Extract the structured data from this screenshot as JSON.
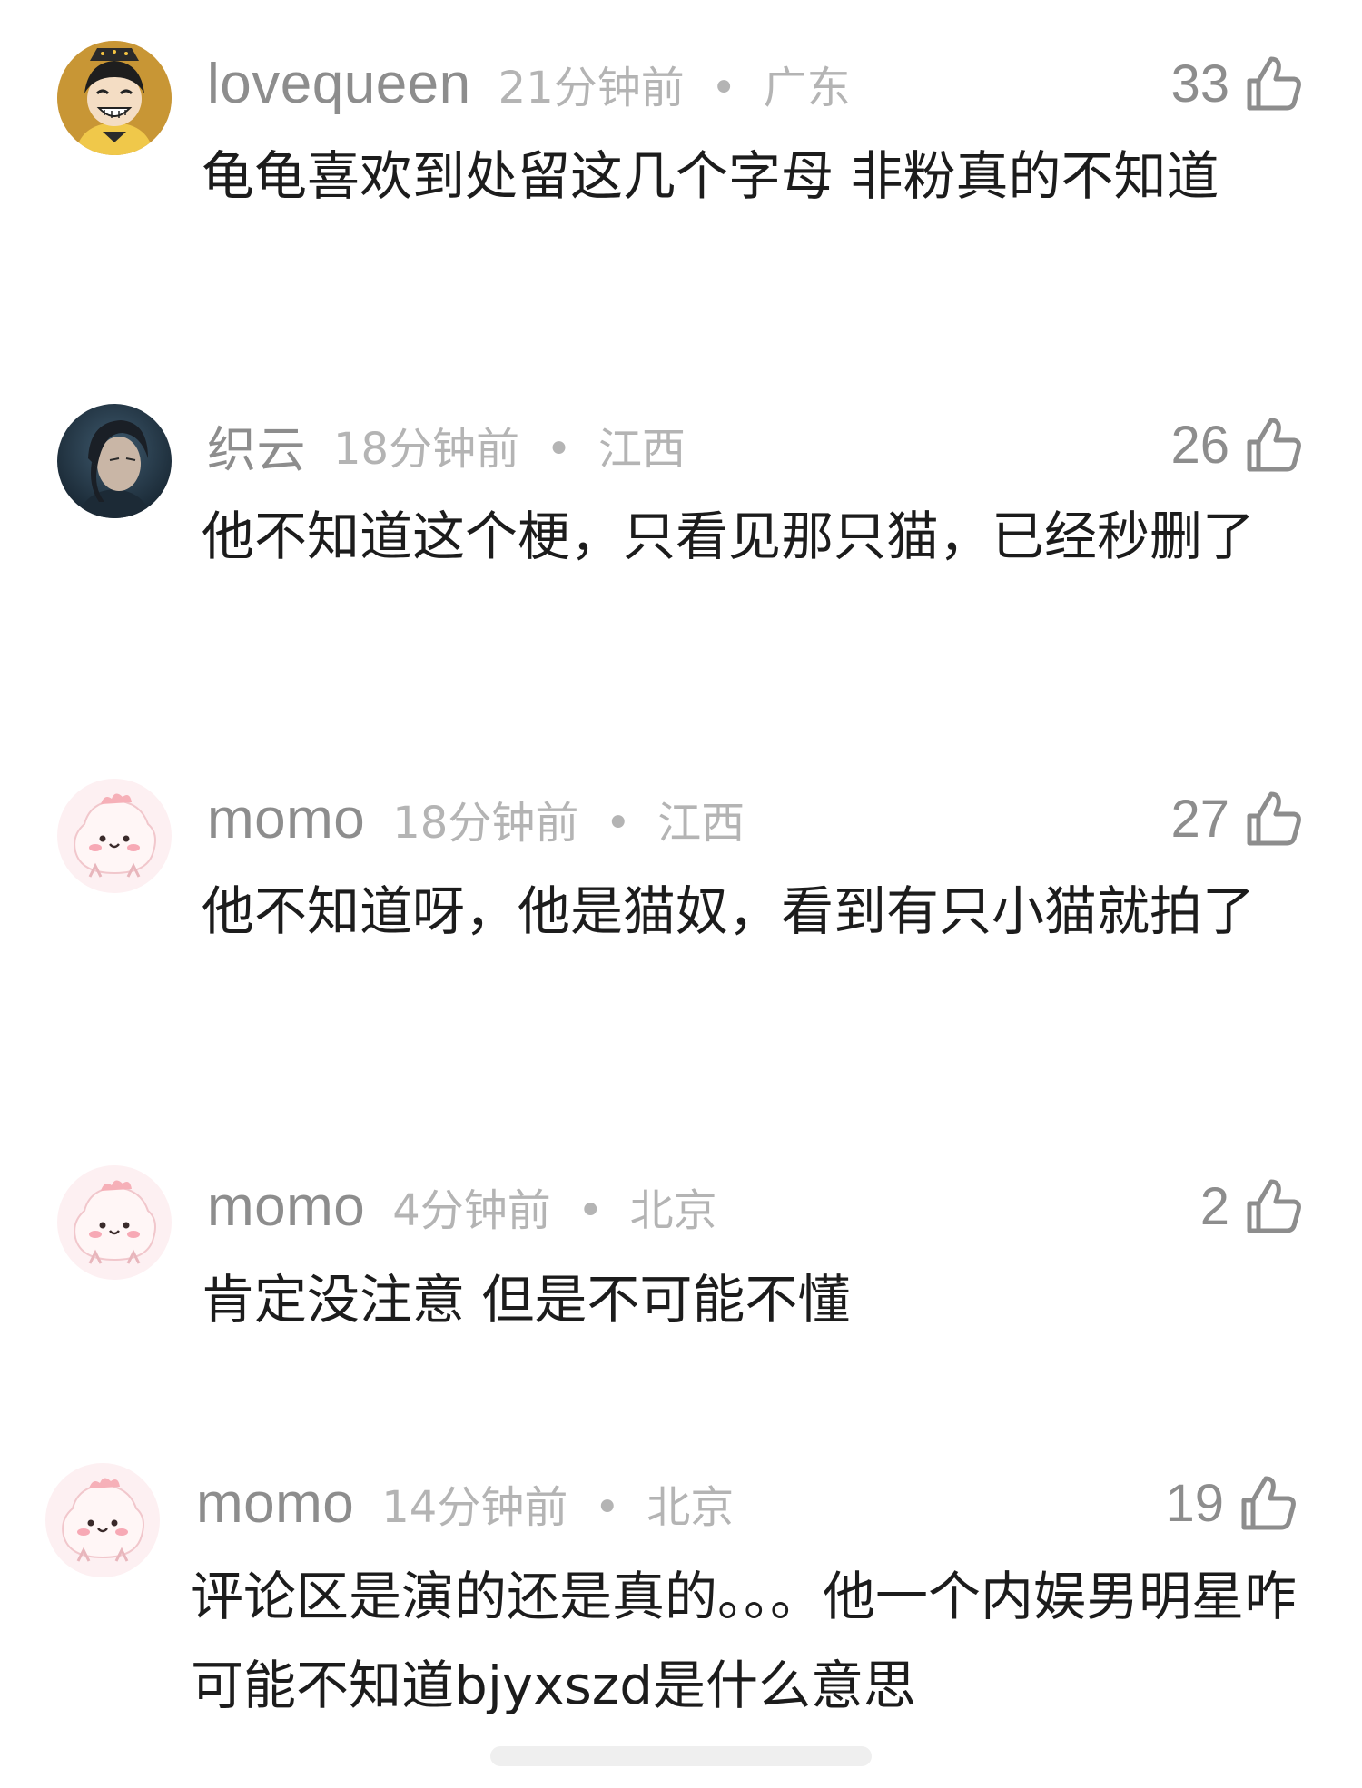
{
  "comments": [
    {
      "username": "lovequeen",
      "time": "21分钟前",
      "separator": "•",
      "location": "广东",
      "likes": "33",
      "text": "龟龟喜欢到处留这几个字母 非粉真的不知道",
      "avatar_icon": "cartoon-character-avatar"
    },
    {
      "username": "织云",
      "time": "18分钟前",
      "separator": "•",
      "location": "江西",
      "likes": "26",
      "text": "他不知道这个梗，只看见那只猫，已经秒删了",
      "avatar_icon": "anime-portrait-avatar"
    },
    {
      "username": "momo",
      "time": "18分钟前",
      "separator": "•",
      "location": "江西",
      "likes": "27",
      "text": "他不知道呀，他是猫奴，看到有只小猫就拍了",
      "avatar_icon": "pink-blob-avatar"
    },
    {
      "username": "momo",
      "time": "4分钟前",
      "separator": "•",
      "location": "北京",
      "likes": "2",
      "text": "肯定没注意 但是不可能不懂",
      "avatar_icon": "pink-blob-avatar"
    },
    {
      "username": "momo",
      "time": "14分钟前",
      "separator": "•",
      "location": "北京",
      "likes": "19",
      "text": "评论区是演的还是真的。。。他一个内娱男明星咋可能不知道bjyxszd是什么意思",
      "avatar_icon": "pink-blob-avatar"
    }
  ],
  "icons": {
    "like": "thumbs-up-icon"
  },
  "colors": {
    "username": "#8d8d8d",
    "meta": "#b4b4b4",
    "text": "#1c1c1c",
    "background": "#ffffff"
  }
}
